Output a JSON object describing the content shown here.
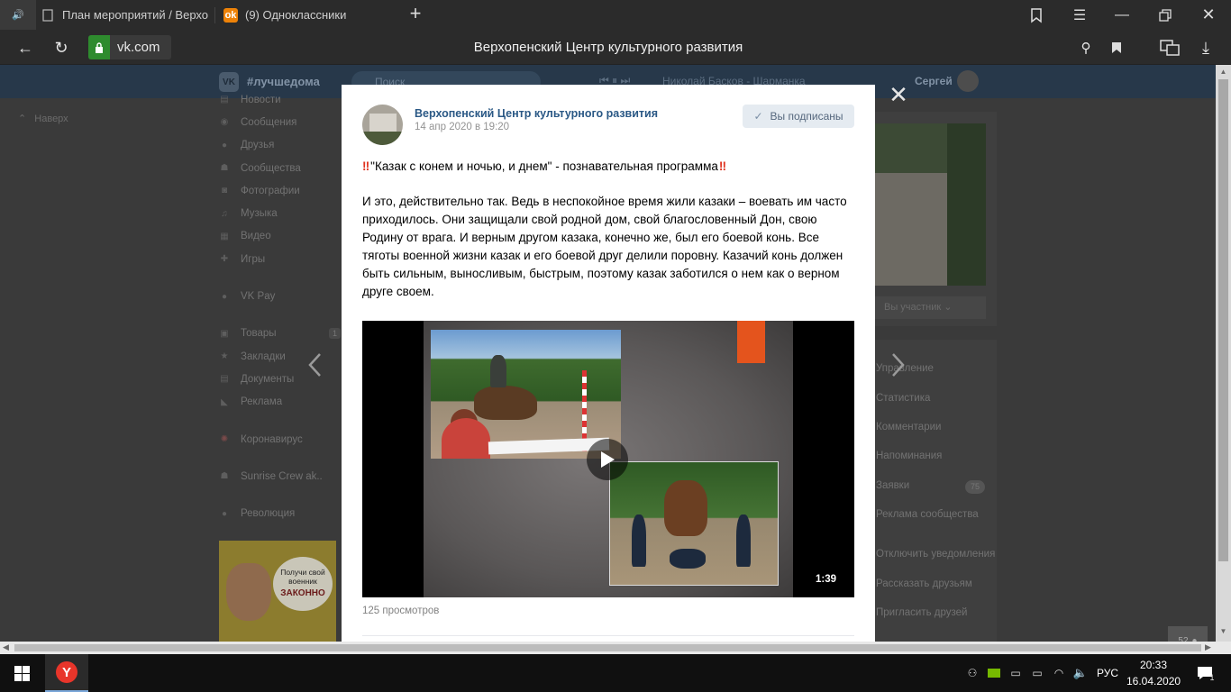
{
  "browser": {
    "tabs": [
      {
        "title": "План мероприятий / Верхо",
        "active": false
      },
      {
        "title": "(9) Одноклассники",
        "active": false
      }
    ],
    "new_tab_label": "+",
    "url_domain": "vk.com",
    "page_title": "Верхопенский Центр культурного развития"
  },
  "vk": {
    "header": {
      "hashtag": "#лучшедома",
      "search_placeholder": "Поиск",
      "player_track": "Николай Басков - Шарманка",
      "user_name": "Сергей"
    },
    "back_label": "Наверх",
    "left_menu": [
      {
        "label": "Новости",
        "icon": "news-icon"
      },
      {
        "label": "Сообщения",
        "icon": "messages-icon"
      },
      {
        "label": "Друзья",
        "icon": "friends-icon"
      },
      {
        "label": "Сообщества",
        "icon": "groups-icon"
      },
      {
        "label": "Фотографии",
        "icon": "photos-icon"
      },
      {
        "label": "Музыка",
        "icon": "music-icon"
      },
      {
        "label": "Видео",
        "icon": "video-icon"
      },
      {
        "label": "Игры",
        "icon": "games-icon"
      },
      {
        "label": "VK Pay",
        "icon": "vkpay-icon"
      },
      {
        "label": "Товары",
        "icon": "goods-icon",
        "badge": "1"
      },
      {
        "label": "Закладки",
        "icon": "bookmarks-icon"
      },
      {
        "label": "Документы",
        "icon": "documents-icon"
      },
      {
        "label": "Реклама",
        "icon": "ads-icon"
      },
      {
        "label": "Коронавирус",
        "icon": "coronavirus-icon"
      },
      {
        "label": "Sunrise Crew ak..",
        "icon": "app-icon"
      },
      {
        "label": "Революция",
        "icon": "revolution-icon"
      }
    ],
    "promo": {
      "line1": "Получи свой",
      "line2": "военник",
      "line3": "ЗАКОННО"
    },
    "right_panel": {
      "member_button": "Вы участник",
      "menu": [
        {
          "label": "Управление"
        },
        {
          "label": "Статистика"
        },
        {
          "label": "Комментарии"
        },
        {
          "label": "Напоминания"
        },
        {
          "label": "Заявки",
          "badge": "75"
        },
        {
          "label": "Реклама сообщества"
        },
        {
          "label": "Отключить уведомления"
        },
        {
          "label": "Рассказать друзьям"
        },
        {
          "label": "Пригласить друзей"
        }
      ]
    },
    "online_count": "52"
  },
  "modal": {
    "group_name": "Верхопенский Центр культурного развития",
    "post_date": "14 апр 2020 в 19:20",
    "subscribed_label": "Вы подписаны",
    "headline_marks": "‼",
    "headline": "\"Казак с конем и ночью, и днем\" - познавательная программа",
    "body": "И это, действительно так. Ведь в неспокойное время жили казаки – воевать им часто приходилось. Они защищали свой родной дом, свой благословенный Дон, свою Родину от врага. И верным другом казака, конечно же, был его боевой конь. Все тяготы военной жизни казак и его боевой друг делили поровну. Казачий конь должен быть сильным, выносливым, быстрым, поэтому казак заботился о нем как о верном друге своем.",
    "video_duration": "1:39",
    "views": "125 просмотров"
  },
  "taskbar": {
    "lang": "РУС",
    "time": "20:33",
    "date": "16.04.2020",
    "notifications_count": "1"
  },
  "colors": {
    "vk_link": "#2a5885",
    "vk_header": "#27384a",
    "secure_green": "#2e8b2e",
    "alert_red": "#e0331f"
  }
}
